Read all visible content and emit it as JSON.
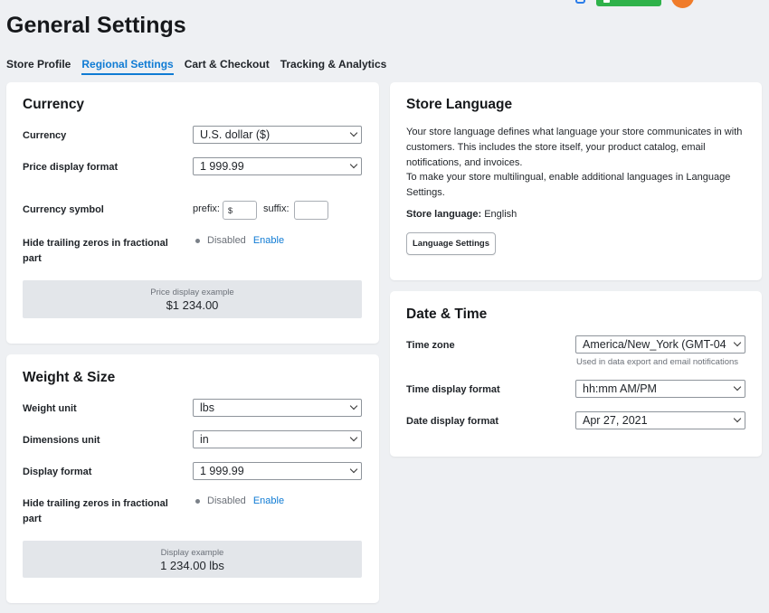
{
  "page": {
    "title": "General Settings"
  },
  "tabs": [
    {
      "label": "Store Profile"
    },
    {
      "label": "Regional Settings"
    },
    {
      "label": "Cart & Checkout"
    },
    {
      "label": "Tracking & Analytics"
    }
  ],
  "currency": {
    "title": "Currency",
    "currency_label": "Currency",
    "currency_value": "U.S. dollar ($)",
    "price_format_label": "Price display format",
    "price_format_value": "1 999.99",
    "symbol_label": "Currency symbol",
    "prefix_label": "prefix:",
    "prefix_value": "$",
    "suffix_label": "suffix:",
    "suffix_value": "",
    "hide_zeros_label": "Hide trailing zeros in fractional part",
    "status": "Disabled",
    "enable_link": "Enable",
    "example_label": "Price display example",
    "example_value": "$1 234.00"
  },
  "weight": {
    "title": "Weight & Size",
    "weight_unit_label": "Weight unit",
    "weight_unit_value": "lbs",
    "dimensions_label": "Dimensions unit",
    "dimensions_value": "in",
    "display_format_label": "Display format",
    "display_format_value": "1 999.99",
    "hide_zeros_label": "Hide trailing zeros in fractional part",
    "status": "Disabled",
    "enable_link": "Enable",
    "example_label": "Display example",
    "example_value": "1 234.00 lbs"
  },
  "language": {
    "title": "Store Language",
    "description": "Your store language defines what language your store communicates in with customers. This includes the store itself, your product catalog, email notifications, and invoices.",
    "multilingual": "To make your store multilingual, enable additional languages in Language Settings.",
    "store_language_label": "Store language:",
    "store_language_value": "English",
    "button": "Language Settings"
  },
  "datetime": {
    "title": "Date & Time",
    "timezone_label": "Time zone",
    "timezone_value": "America/New_York (GMT-04",
    "timezone_hint": "Used in data export and email notifications",
    "time_format_label": "Time display format",
    "time_format_value": "hh:mm AM/PM",
    "date_format_label": "Date display format",
    "date_format_value": "Apr 27, 2021"
  },
  "icons": {
    "topbar": [
      "help-icon",
      "upgrade-button",
      "user-avatar",
      "more-icon"
    ],
    "select": "chevron-down-icon",
    "status": "status-dot-icon"
  },
  "colors": {
    "accent": "#0f7bd4",
    "background": "#eef0f3",
    "upgrade": "#2fb24a",
    "avatar": "#f07c2a"
  }
}
